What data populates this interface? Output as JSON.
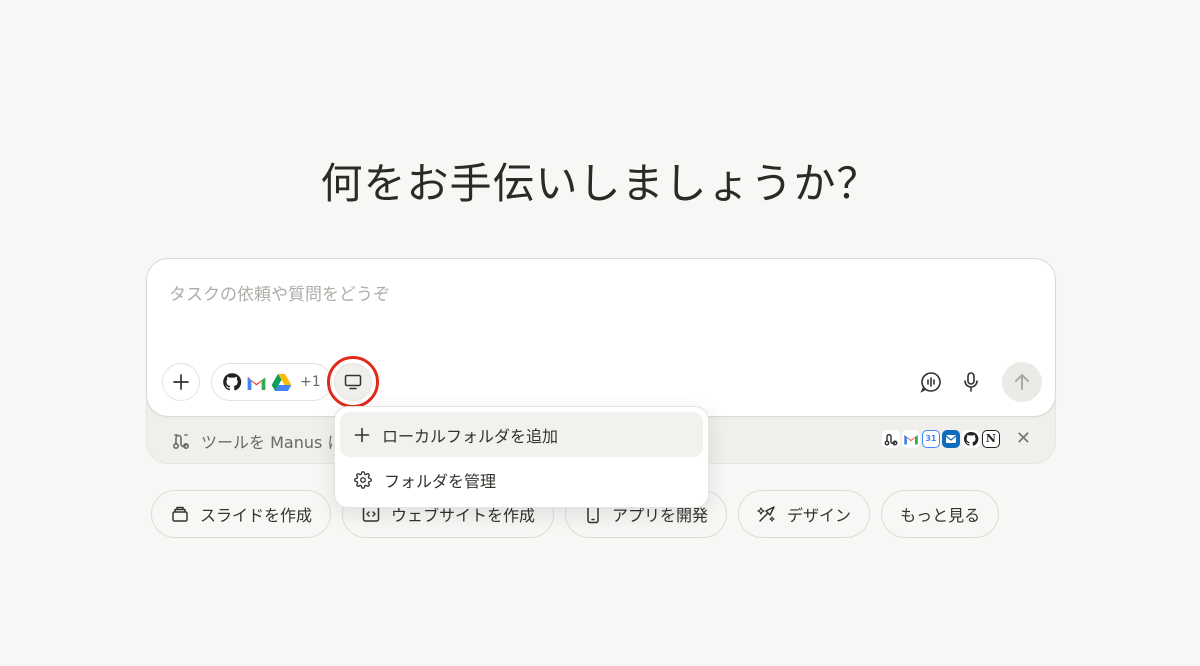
{
  "heading": "何をお手伝いしましょうか？",
  "composer": {
    "placeholder": "タスクの依頼や質問をどうぞ",
    "connectors_more": "+1"
  },
  "tools_bar": {
    "label": "ツールを Manus に",
    "connected_icons": [
      "flow-icon",
      "gmail-icon",
      "calendar-icon",
      "outlook-icon",
      "github-icon",
      "notion-icon"
    ]
  },
  "menu": {
    "items": [
      {
        "label": "ローカルフォルダを追加",
        "icon": "plus-icon"
      },
      {
        "label": "フォルダを管理",
        "icon": "gear-icon"
      }
    ]
  },
  "chips": [
    {
      "label": "スライドを作成",
      "icon": "slides-icon"
    },
    {
      "label": "ウェブサイトを作成",
      "icon": "code-icon"
    },
    {
      "label": "アプリを開発",
      "icon": "mobile-icon"
    },
    {
      "label": "デザイン",
      "icon": "design-icon"
    },
    {
      "label": "もっと見る",
      "icon": ""
    }
  ],
  "colors": {
    "background": "#f7f7f5",
    "highlight_ring": "#e02a1b",
    "text": "#34322d"
  }
}
